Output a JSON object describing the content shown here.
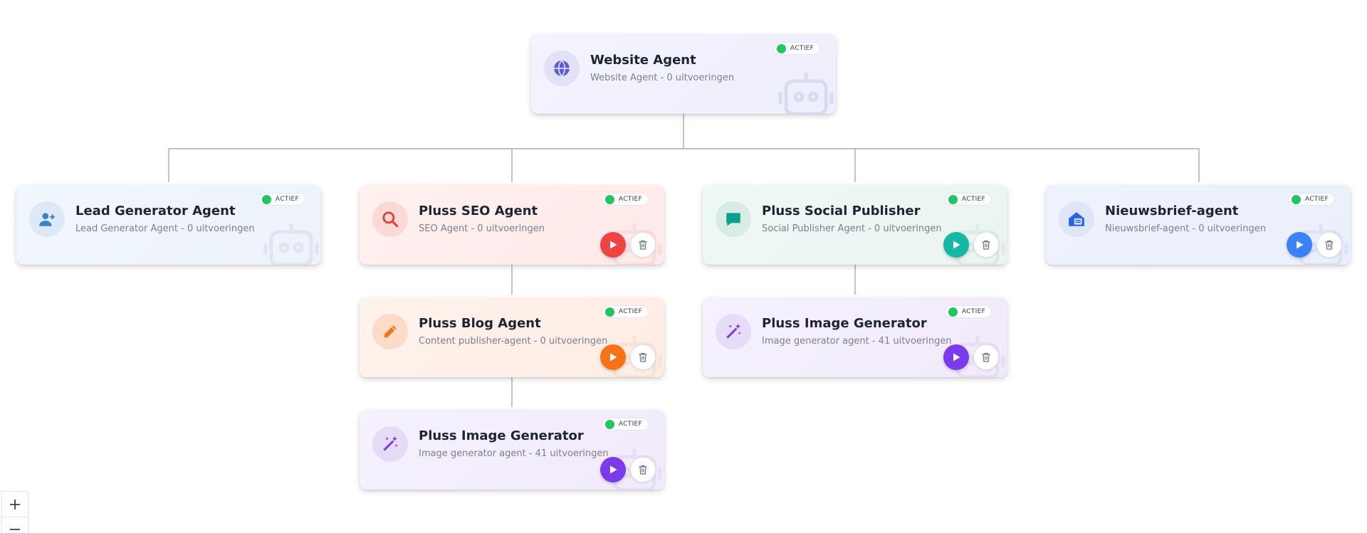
{
  "status_label": "ACTIEF",
  "colors": {
    "status_active": "#22c55e",
    "connector": "#a8abb3",
    "run_red": "#ef4444",
    "run_teal": "#14b8a6",
    "run_blue": "#3b82f6",
    "run_orange": "#f97316",
    "run_purple": "#7c3aed"
  },
  "agents": [
    {
      "id": "website",
      "title": "Website Agent",
      "subtitle": "Website Agent - 0 uitvoeringen",
      "icon": "globe-icon",
      "theme": "indigo",
      "status": "ACTIEF",
      "has_actions": false
    },
    {
      "id": "lead",
      "title": "Lead Generator Agent",
      "subtitle": "Lead Generator Agent - 0 uitvoeringen",
      "icon": "user-plus-icon",
      "theme": "sky",
      "status": "ACTIEF",
      "has_actions": false
    },
    {
      "id": "seo",
      "title": "Pluss SEO Agent",
      "subtitle": "SEO Agent - 0 uitvoeringen",
      "icon": "search-icon",
      "theme": "red",
      "status": "ACTIEF",
      "has_actions": true
    },
    {
      "id": "social",
      "title": "Pluss Social Publisher",
      "subtitle": "Social Publisher Agent - 0 uitvoeringen",
      "icon": "chat-bubble-icon",
      "theme": "teal",
      "status": "ACTIEF",
      "has_actions": true
    },
    {
      "id": "newsletter",
      "title": "Nieuwsbrief-agent",
      "subtitle": "Nieuwsbrief-agent - 0 uitvoeringen",
      "icon": "mail-house-icon",
      "theme": "blue",
      "status": "ACTIEF",
      "has_actions": true
    },
    {
      "id": "blog",
      "title": "Pluss Blog Agent",
      "subtitle": "Content publisher-agent - 0 uitvoeringen",
      "icon": "pencil-icon",
      "theme": "orange",
      "status": "ACTIEF",
      "has_actions": true
    },
    {
      "id": "image-social",
      "title": "Pluss Image Generator",
      "subtitle": "Image generator agent - 41 uitvoeringen",
      "icon": "magic-wand-icon",
      "theme": "purple",
      "status": "ACTIEF",
      "has_actions": true
    },
    {
      "id": "image-blog",
      "title": "Pluss Image Generator",
      "subtitle": "Image generator agent - 41 uitvoeringen",
      "icon": "magic-wand-icon",
      "theme": "purple",
      "status": "ACTIEF",
      "has_actions": true
    }
  ],
  "hierarchy": [
    {
      "parent": "website",
      "child": "lead"
    },
    {
      "parent": "website",
      "child": "seo"
    },
    {
      "parent": "website",
      "child": "social"
    },
    {
      "parent": "website",
      "child": "newsletter"
    },
    {
      "parent": "seo",
      "child": "blog"
    },
    {
      "parent": "blog",
      "child": "image-blog"
    },
    {
      "parent": "social",
      "child": "image-social"
    }
  ],
  "zoom_controls": {
    "zoom_in": "+",
    "zoom_out": "−"
  }
}
